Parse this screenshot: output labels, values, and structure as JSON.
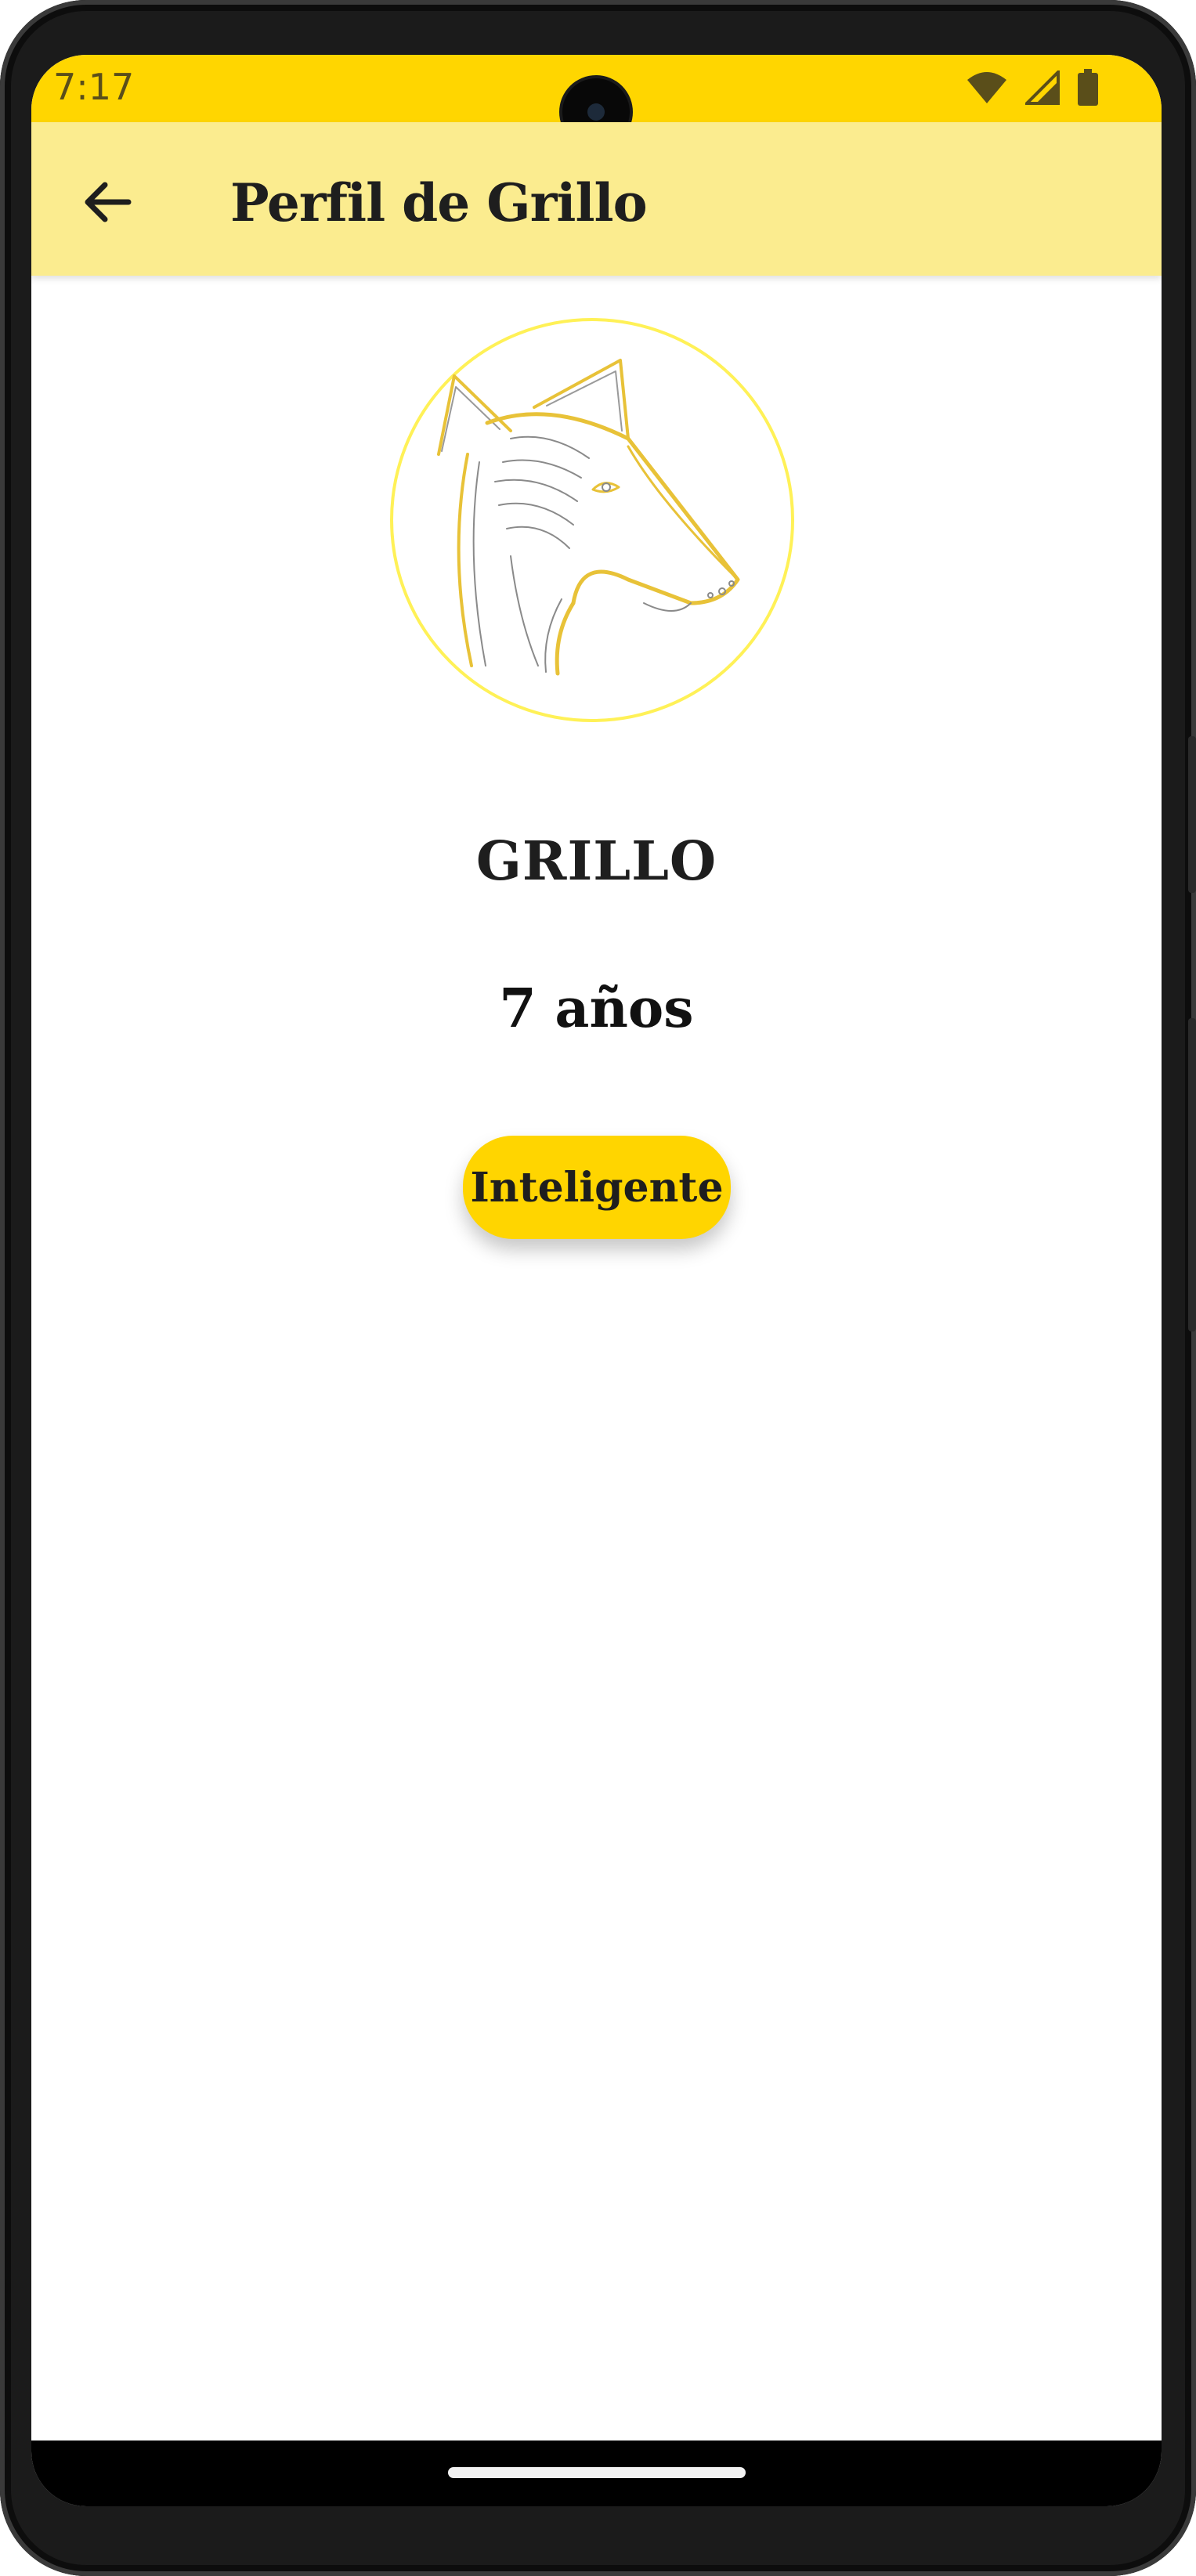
{
  "status_bar": {
    "time": "7:17",
    "icons": [
      "wifi-icon",
      "signal-icon",
      "battery-icon"
    ]
  },
  "app_bar": {
    "title": "Perfil de Grillo",
    "back_icon": "arrow-back-icon"
  },
  "profile": {
    "avatar": "dog-line-art-image",
    "name": "GRILLO",
    "age": "7 años",
    "trait": "Inteligente"
  },
  "colors": {
    "status_bar": "#FFD600",
    "app_bar": "#FBEC8F",
    "chip": "#FFD500",
    "avatar_border": "#FFF157",
    "line_art": "#E8C238"
  }
}
